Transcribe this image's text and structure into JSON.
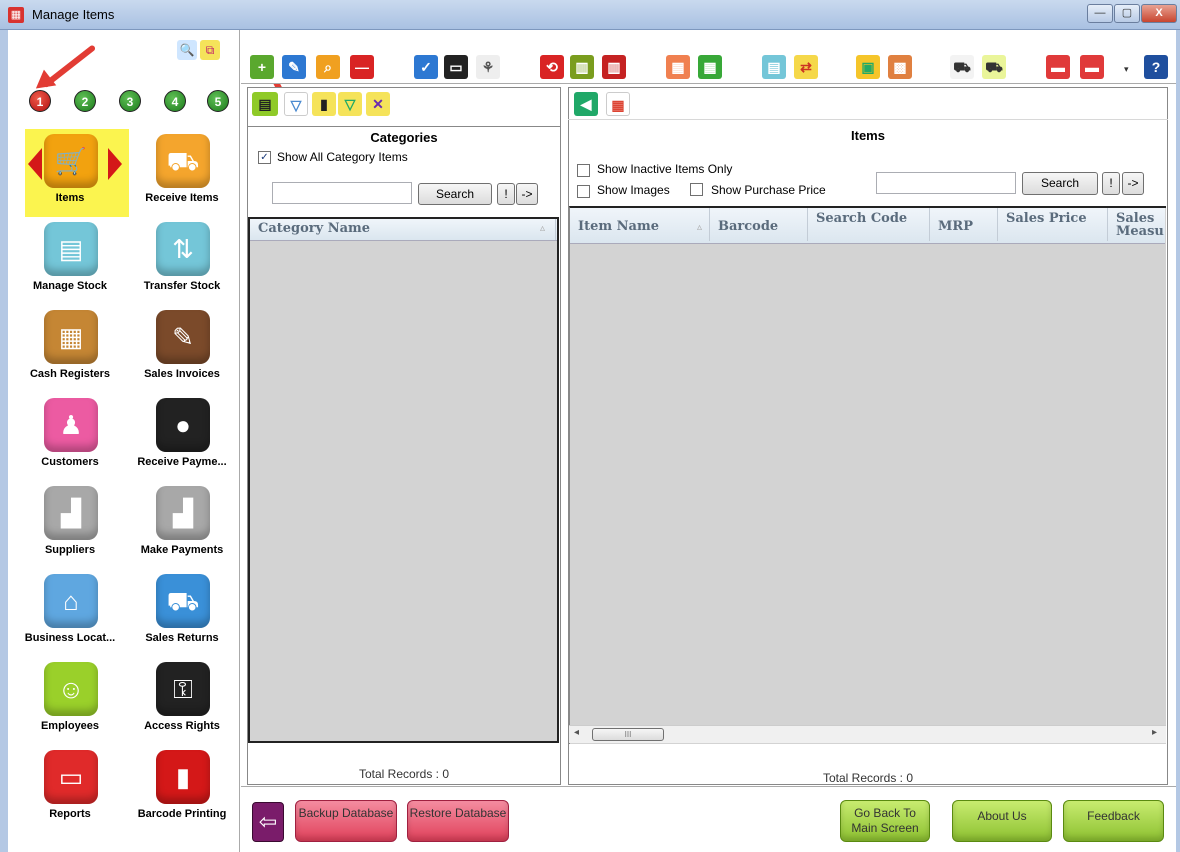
{
  "window": {
    "title": "Manage Items",
    "minimize": "—",
    "maximize": "▢",
    "close": "X"
  },
  "sidebar": {
    "numbers": [
      "1",
      "2",
      "3",
      "4",
      "5"
    ],
    "items": [
      {
        "label": "Items",
        "icon": "shopping-cart-icon",
        "color": "#f2a20f"
      },
      {
        "label": "Receive Items",
        "icon": "delivery-truck-icon",
        "color": "#f4a52d"
      },
      {
        "label": "Manage Stock",
        "icon": "cart-boxes-icon",
        "color": "#74c6d8"
      },
      {
        "label": "Transfer Stock",
        "icon": "transfer-boxes-icon",
        "color": "#74c6d8"
      },
      {
        "label": "Cash Registers",
        "icon": "cash-register-icon",
        "color": "#c58634"
      },
      {
        "label": "Sales Invoices",
        "icon": "invoice-icon",
        "color": "#7b4a2a"
      },
      {
        "label": "Customers",
        "icon": "customers-icon",
        "color": "#ec5ba2"
      },
      {
        "label": "Receive Payme...",
        "icon": "coins-icon",
        "color": "#222222"
      },
      {
        "label": "Suppliers",
        "icon": "factory-icon",
        "color": "#a8a8a8"
      },
      {
        "label": "Make Payments",
        "icon": "factory-payment-icon",
        "color": "#a8a8a8"
      },
      {
        "label": "Business Locat...",
        "icon": "store-icon",
        "color": "#5fa7e0"
      },
      {
        "label": "Sales Returns",
        "icon": "return-cart-icon",
        "color": "#3a90d8"
      },
      {
        "label": "Employees",
        "icon": "employee-icon",
        "color": "#9ad02a"
      },
      {
        "label": "Access Rights",
        "icon": "lock-key-icon",
        "color": "#222222"
      },
      {
        "label": "Reports",
        "icon": "report-icon",
        "color": "#e02a2a"
      },
      {
        "label": "Barcode Printing",
        "icon": "barcode-icon",
        "color": "#d41818"
      }
    ]
  },
  "categories": {
    "title": "Categories",
    "show_all_label": "Show All Category Items",
    "show_all_checked": true,
    "search_value": "",
    "search_button": "Search",
    "excl_button": "!",
    "arrow_button": "->",
    "column": "Category Name",
    "total_records": "Total Records : 0"
  },
  "items": {
    "title": "Items",
    "show_inactive_label": "Show Inactive Items Only",
    "show_images_label": "Show Images",
    "show_purchase_label": "Show Purchase Price",
    "search_value": "",
    "search_button": "Search",
    "excl_button": "!",
    "arrow_button": "->",
    "columns": [
      "Item Name",
      "Barcode",
      "Search Code",
      "MRP",
      "Sales Price",
      "Sales Measu"
    ],
    "total_records": "Total Records : 0",
    "scroll_mark": "III"
  },
  "bottom": {
    "backup_label": "Backup Database",
    "restore_label": "Restore Database",
    "back_main_label": "Go Back To Main Screen",
    "about_label": "About Us",
    "feedback_label": "Feedback"
  },
  "colors": {
    "accent_yellow": "#fbf44f",
    "annotation_red": "#e23c34",
    "grid_gray": "#d3d3d3"
  }
}
